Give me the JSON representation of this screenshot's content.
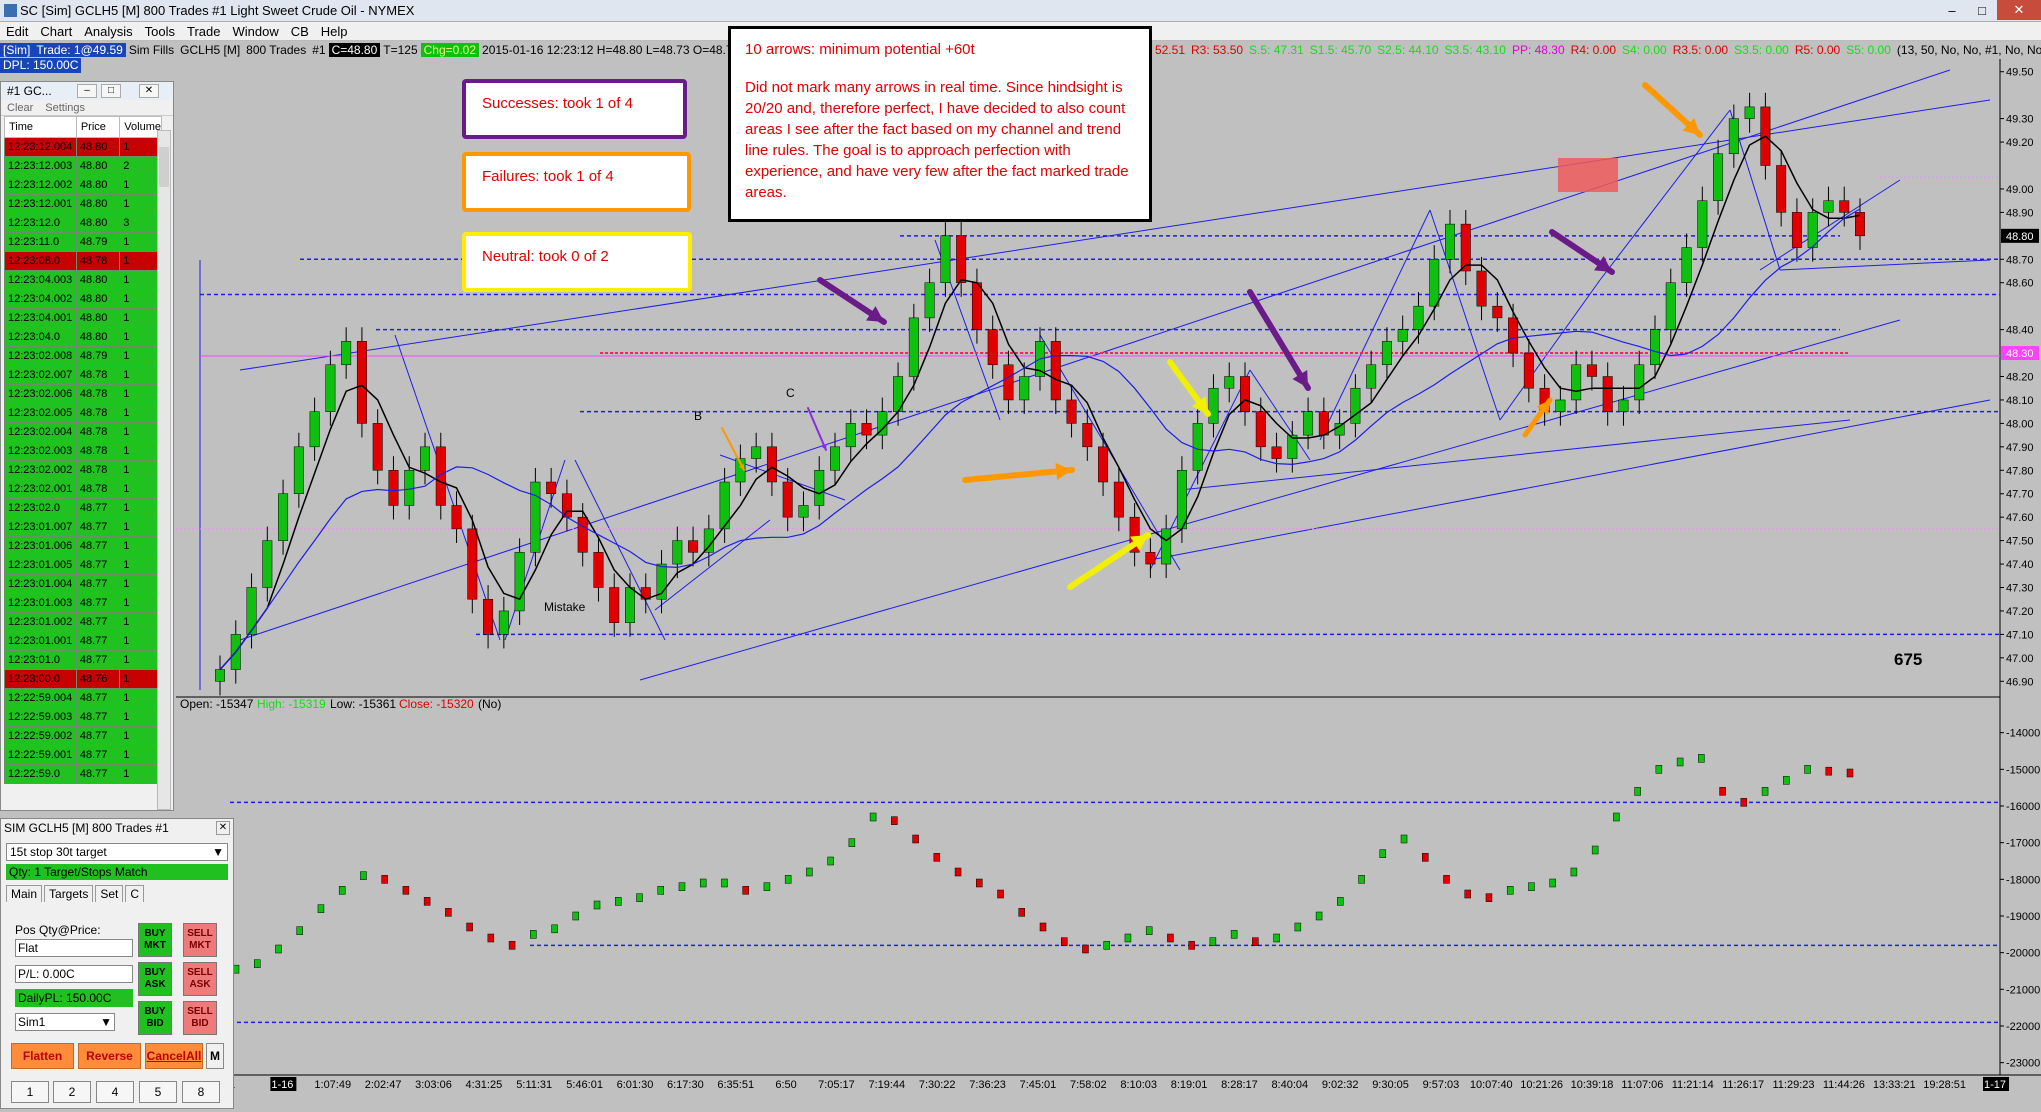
{
  "window": {
    "title": "SC [Sim] GCLH5 [M]  800 Trades  #1  Light Sweet Crude Oil - NYMEX"
  },
  "menu": [
    "Edit",
    "Chart",
    "Analysis",
    "Tools",
    "Trade",
    "Window",
    "CB",
    "Help"
  ],
  "infobar": {
    "sim": "[Sim]",
    "trade": "Trade: 1@49.59",
    "simfills": "Sim Fills",
    "symbol": "GCLH5 [M]",
    "trades": "800 Trades",
    "num": "#1",
    "c": "C=48.80",
    "t": "T=125",
    "chg": "Chg=0.02",
    "ohlc": "2015-01-16 12:23:12 H=48.80 L=48.73 O=48.76 V=147",
    "r1": "2.5: 52.51",
    "r3": "R3: 53.50",
    "s5": "S.5: 47.31",
    "s15": "S1.5: 45.70",
    "s25": "S2.5: 44.10",
    "s35": "S3.5: 43.10",
    "pp": "PP: 48.30",
    "r4": "R4: 0.00",
    "s4": "S4: 0.00",
    "r35": "R3.5: 0.00",
    "s35b": "S3.5: 0.00",
    "r5": "R5: 0.00",
    "s5b": "S5: 0.00",
    "params": "(13, 50, No, No, #1, No, No, No,"
  },
  "dpl": "DPL: 150.00C",
  "annotations": {
    "main_title": "10 arrows: minimum potential +60t",
    "main_body": "Did not mark many arrows in real time.  Since hindsight is 20/20 and, therefore perfect, I have decided to also count areas I see after the fact based on my channel and trend line rules.  The goal is to approach perfection with experience, and have very few after the fact marked trade areas.",
    "successes": "Successes: took 1 of 4",
    "failures": "Failures: took 1 of 4",
    "neutral": "Neutral: took 0 of 2",
    "label_b": "B",
    "label_c": "C",
    "mistake": "Mistake",
    "count": "675"
  },
  "chart_data": [
    {
      "type": "candlestick",
      "price_axis": [
        "49.50",
        "49.30",
        "49.20",
        "49.00",
        "48.90",
        "48.70",
        "48.60",
        "48.40",
        "48.20",
        "48.10",
        "48.00",
        "47.90",
        "47.80",
        "47.70",
        "47.60",
        "47.50",
        "47.40",
        "47.30",
        "47.20",
        "47.10",
        "47.00",
        "46.90"
      ],
      "price_values": [
        49.5,
        49.3,
        49.2,
        49.0,
        48.9,
        48.7,
        48.6,
        48.4,
        48.2,
        48.1,
        48.0,
        47.9,
        47.8,
        47.7,
        47.6,
        47.5,
        47.4,
        47.3,
        47.2,
        47.1,
        47.0,
        46.9
      ],
      "ylim": [
        46.85,
        49.55
      ],
      "last_price": "48.80",
      "pivot_price": "48.30",
      "closes": [
        46.95,
        47.1,
        47.3,
        47.5,
        47.7,
        47.9,
        48.05,
        48.25,
        48.35,
        48.0,
        47.8,
        47.65,
        47.8,
        47.9,
        47.65,
        47.55,
        47.25,
        47.1,
        47.2,
        47.45,
        47.75,
        47.7,
        47.6,
        47.45,
        47.3,
        47.15,
        47.3,
        47.25,
        47.4,
        47.5,
        47.45,
        47.55,
        47.75,
        47.85,
        47.9,
        47.75,
        47.6,
        47.65,
        47.8,
        47.9,
        48.0,
        47.95,
        48.05,
        48.2,
        48.45,
        48.6,
        48.8,
        48.6,
        48.4,
        48.25,
        48.1,
        48.2,
        48.35,
        48.1,
        48.0,
        47.9,
        47.75,
        47.6,
        47.45,
        47.4,
        47.55,
        47.8,
        48.0,
        48.15,
        48.2,
        48.05,
        47.9,
        47.85,
        47.95,
        48.05,
        47.95,
        48.0,
        48.15,
        48.25,
        48.35,
        48.4,
        48.5,
        48.7,
        48.85,
        48.65,
        48.5,
        48.45,
        48.3,
        48.15,
        48.05,
        48.1,
        48.25,
        48.2,
        48.05,
        48.1,
        48.25,
        48.4,
        48.6,
        48.75,
        48.95,
        49.15,
        49.3,
        49.35,
        49.1,
        48.9,
        48.75,
        48.9,
        48.95,
        48.9,
        48.8
      ]
    },
    {
      "type": "line",
      "ohlc_label": {
        "open": "Open: -15347",
        "high": "High: -15319",
        "low": "Low: -15361",
        "close": "Close: -15320",
        "extra": "(No)"
      },
      "axis": [
        "-14000",
        "-15000",
        "-16000",
        "-17000",
        "-18000",
        "-19000",
        "-20000",
        "-21000",
        "-22000",
        "-23000"
      ],
      "axis_values": [
        -14000,
        -15000,
        -16000,
        -17000,
        -18000,
        -19000,
        -20000,
        -21000,
        -22000,
        -23000
      ],
      "ylim": [
        -23200,
        -13600
      ],
      "values": [
        -20450,
        -20300,
        -19900,
        -19400,
        -18800,
        -18300,
        -17900,
        -18000,
        -18300,
        -18600,
        -18900,
        -19300,
        -19600,
        -19800,
        -19500,
        -19350,
        -19000,
        -18700,
        -18600,
        -18500,
        -18300,
        -18200,
        -18100,
        -18100,
        -18300,
        -18200,
        -18000,
        -17800,
        -17500,
        -17000,
        -16300,
        -16400,
        -16900,
        -17400,
        -17800,
        -18100,
        -18400,
        -18900,
        -19300,
        -19700,
        -19900,
        -19800,
        -19600,
        -19400,
        -19600,
        -19800,
        -19700,
        -19500,
        -19700,
        -19600,
        -19300,
        -19000,
        -18600,
        -18000,
        -17300,
        -16900,
        -17400,
        -18000,
        -18400,
        -18500,
        -18300,
        -18200,
        -18100,
        -17800,
        -17200,
        -16300,
        -15600,
        -15000,
        -14800,
        -14700,
        -15600,
        -15900,
        -15600,
        -15300,
        -15000,
        -15050,
        -15100
      ]
    }
  ],
  "time_axis": [
    "1",
    "1-16",
    "1:07:49",
    "2:02:47",
    "3:03:06",
    "4:31:25",
    "5:11:31",
    "5:46:01",
    "6:01:30",
    "6:17:30",
    "6:35:51",
    "6:50",
    "7:05:17",
    "7:19:44",
    "7:30:22",
    "7:36:23",
    "7:45:01",
    "7:58:02",
    "8:10:03",
    "8:19:01",
    "8:28:17",
    "8:40:04",
    "9:02:32",
    "9:30:05",
    "9:57:03",
    "10:07:40",
    "10:21:26",
    "10:39:18",
    "11:07:06",
    "11:21:14",
    "11:26:17",
    "11:29:23",
    "11:44:26",
    "13:33:21",
    "19:28:51",
    "1-17"
  ],
  "tas": {
    "title": "#1 GC...",
    "toolbar": [
      "Clear",
      "Settings"
    ],
    "columns": [
      "Time",
      "Price",
      "Volume"
    ],
    "rows": [
      {
        "t": "12:23:12.004",
        "p": "48.80",
        "v": "1",
        "c": "r"
      },
      {
        "t": "12:23:12.003",
        "p": "48.80",
        "v": "2",
        "c": "g"
      },
      {
        "t": "12:23:12.002",
        "p": "48.80",
        "v": "1",
        "c": "g"
      },
      {
        "t": "12:23:12.001",
        "p": "48.80",
        "v": "1",
        "c": "g"
      },
      {
        "t": "12:23:12.0",
        "p": "48.80",
        "v": "3",
        "c": "g"
      },
      {
        "t": "12:23:11.0",
        "p": "48.79",
        "v": "1",
        "c": "g"
      },
      {
        "t": "12:23:08.0",
        "p": "48.78",
        "v": "1",
        "c": "r"
      },
      {
        "t": "12:23:04.003",
        "p": "48.80",
        "v": "1",
        "c": "g"
      },
      {
        "t": "12:23:04.002",
        "p": "48.80",
        "v": "1",
        "c": "g"
      },
      {
        "t": "12:23:04.001",
        "p": "48.80",
        "v": "1",
        "c": "g"
      },
      {
        "t": "12:23:04.0",
        "p": "48.80",
        "v": "1",
        "c": "g"
      },
      {
        "t": "12:23:02.008",
        "p": "48.79",
        "v": "1",
        "c": "g"
      },
      {
        "t": "12:23:02.007",
        "p": "48.78",
        "v": "1",
        "c": "g"
      },
      {
        "t": "12:23:02.006",
        "p": "48.78",
        "v": "1",
        "c": "g"
      },
      {
        "t": "12:23:02.005",
        "p": "48.78",
        "v": "1",
        "c": "g"
      },
      {
        "t": "12:23:02.004",
        "p": "48.78",
        "v": "1",
        "c": "g"
      },
      {
        "t": "12:23:02.003",
        "p": "48.78",
        "v": "1",
        "c": "g"
      },
      {
        "t": "12:23:02.002",
        "p": "48.78",
        "v": "1",
        "c": "g"
      },
      {
        "t": "12:23:02.001",
        "p": "48.78",
        "v": "1",
        "c": "g"
      },
      {
        "t": "12:23:02.0",
        "p": "48.77",
        "v": "1",
        "c": "g"
      },
      {
        "t": "12:23:01.007",
        "p": "48.77",
        "v": "1",
        "c": "g"
      },
      {
        "t": "12:23:01.006",
        "p": "48.77",
        "v": "1",
        "c": "g"
      },
      {
        "t": "12:23:01.005",
        "p": "48.77",
        "v": "1",
        "c": "g"
      },
      {
        "t": "12:23:01.004",
        "p": "48.77",
        "v": "1",
        "c": "g"
      },
      {
        "t": "12:23:01.003",
        "p": "48.77",
        "v": "1",
        "c": "g"
      },
      {
        "t": "12:23:01.002",
        "p": "48.77",
        "v": "1",
        "c": "g"
      },
      {
        "t": "12:23:01.001",
        "p": "48.77",
        "v": "1",
        "c": "g"
      },
      {
        "t": "12:23:01.0",
        "p": "48.77",
        "v": "1",
        "c": "g"
      },
      {
        "t": "12:23:00.0",
        "p": "48.76",
        "v": "1",
        "c": "r"
      },
      {
        "t": "12:22:59.004",
        "p": "48.77",
        "v": "1",
        "c": "g"
      },
      {
        "t": "12:22:59.003",
        "p": "48.77",
        "v": "1",
        "c": "g"
      },
      {
        "t": "12:22:59.002",
        "p": "48.77",
        "v": "1",
        "c": "g"
      },
      {
        "t": "12:22:59.001",
        "p": "48.77",
        "v": "1",
        "c": "g"
      },
      {
        "t": "12:22:59.0",
        "p": "48.77",
        "v": "1",
        "c": "g"
      }
    ]
  },
  "trade_panel": {
    "title": "SIM GCLH5 [M]  800 Trades  #1",
    "strategy": "15t stop 30t target",
    "qty": "Qty: 1 Target/Stops Match",
    "tabs": [
      "Main",
      "Targets",
      "Set",
      "C"
    ],
    "pos_label": "Pos Qty@Price:",
    "pos_value": "Flat",
    "pl": "P/L: 0.00C",
    "daily": "DailyPL: 150.00C",
    "account": "Sim1",
    "buy_mkt": "BUY MKT",
    "sell_mkt": "SELL MKT",
    "buy_ask": "BUY ASK",
    "sell_ask": "SELL ASK",
    "buy_bid": "BUY BID",
    "sell_bid": "SELL BID",
    "flatten": "Flatten",
    "reverse": "Reverse",
    "cancel_all": "CancelAll",
    "m": "M",
    "qty_buttons": [
      "1",
      "2",
      "4",
      "5",
      "8"
    ]
  },
  "colors": {
    "up": "#10c010",
    "down": "#e00000",
    "bg": "#c0c0c0",
    "line": "#2020e0"
  }
}
